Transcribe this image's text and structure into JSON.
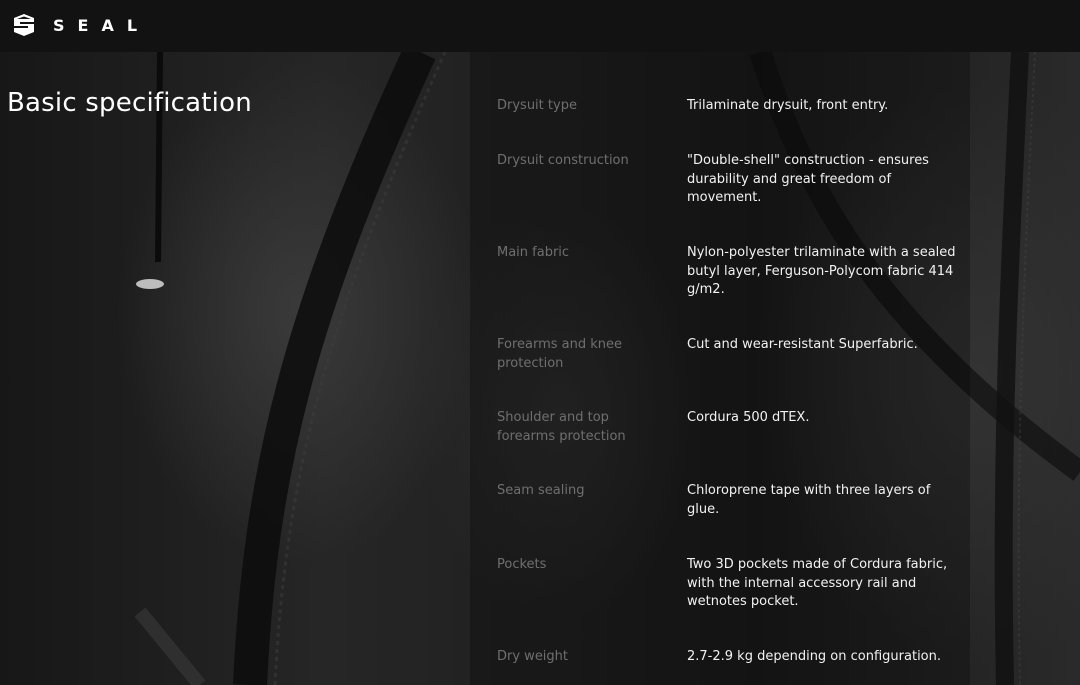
{
  "brand": {
    "name": "SEAL",
    "logo_icon": "seal-logo-icon"
  },
  "section": {
    "title": "Basic specification"
  },
  "specs": [
    {
      "label": "Drysuit type",
      "value": "Trilaminate drysuit, front entry."
    },
    {
      "label": "Drysuit construction",
      "value": "\"Double-shell\" construction - ensures durability and great freedom of movement."
    },
    {
      "label": "Main fabric",
      "value": "Nylon-polyester trilaminate with a sealed butyl layer, Ferguson-Polycom fabric 414 g/m2."
    },
    {
      "label": "Forearms and knee protection",
      "value": "Cut and wear-resistant Superfabric."
    },
    {
      "label": "Shoulder and top forearms protection",
      "value": "Cordura 500 dTEX."
    },
    {
      "label": "Seam sealing",
      "value": "Chloroprene tape with three layers of glue."
    },
    {
      "label": "Pockets",
      "value": "Two 3D pockets made of Cordura fabric, with the internal accessory rail and wetnotes pocket."
    },
    {
      "label": "Dry weight",
      "value": "2.7-2.9 kg depending on configuration."
    }
  ],
  "colors": {
    "background": "#141414",
    "label": "#6f6f6f",
    "value": "#f2f2f2"
  }
}
